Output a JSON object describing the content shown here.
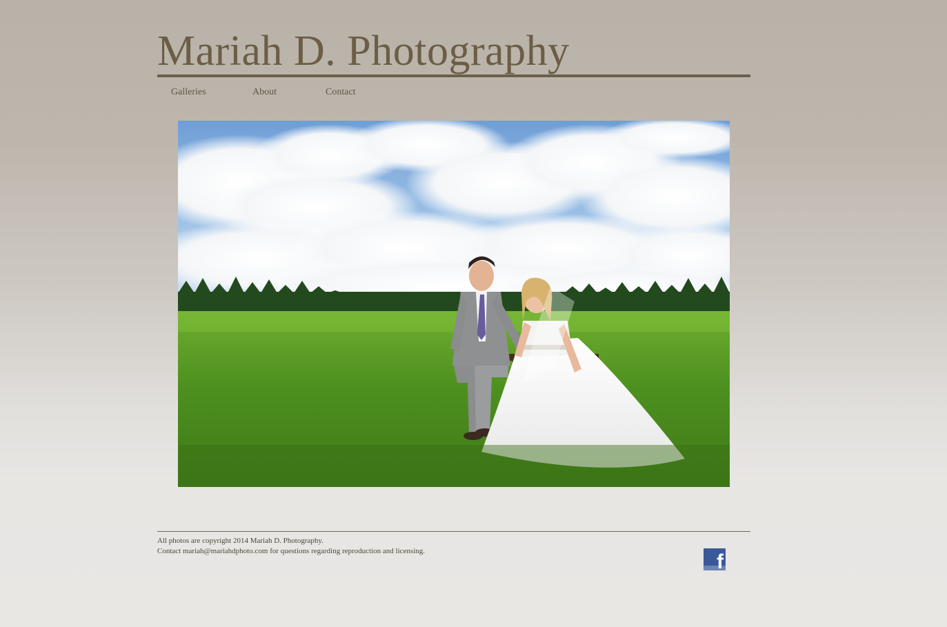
{
  "site": {
    "title": "Mariah D. Photography"
  },
  "nav": {
    "items": [
      {
        "label": "Galleries"
      },
      {
        "label": "About"
      },
      {
        "label": "Contact"
      }
    ]
  },
  "footer": {
    "copyright": "All photos are copyright 2014 Mariah D. Photography.",
    "contact_prefix": "Contact ",
    "email": "mariahdphoto.com",
    "email_full": "mariah@mariahdphoto.com",
    "contact_suffix": " for questions regarding reproduction and licensing.",
    "social_icon": "facebook-icon"
  },
  "colors": {
    "title": "#6b5e45",
    "rule": "#6a5f48",
    "facebook": "#3b5998"
  }
}
